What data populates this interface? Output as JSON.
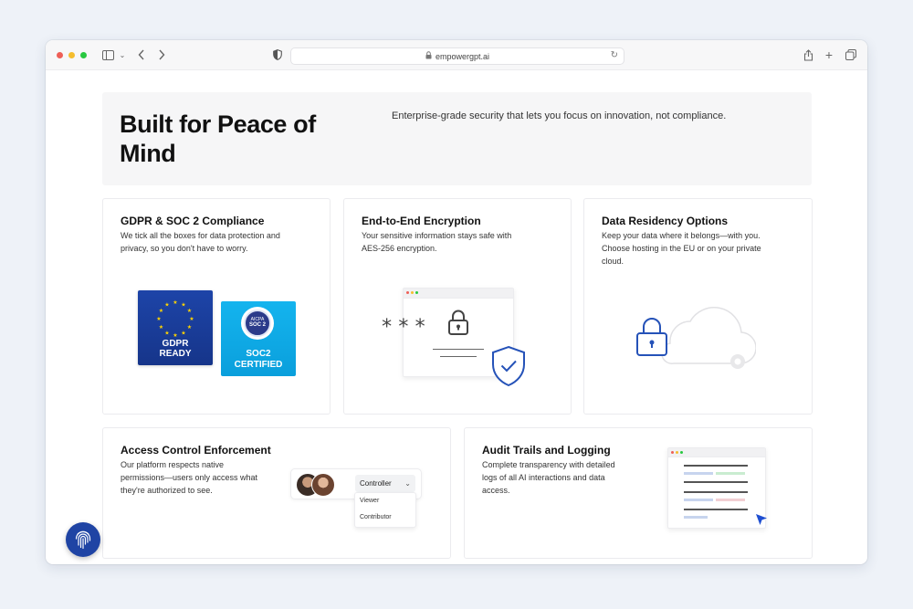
{
  "browser": {
    "url": "empowergpt.ai",
    "colors": {
      "close": "#ee5f57",
      "minimize": "#f5bd2e",
      "zoom": "#28c840"
    }
  },
  "hero": {
    "title": "Built for Peace of Mind",
    "subtitle": "Enterprise-grade security that lets you focus on innovation, not compliance."
  },
  "cards": {
    "gdpr": {
      "title": "GDPR & SOC 2 Compliance",
      "desc_line1": "We tick all the boxes for data protection and",
      "desc_line2": "privacy, so you don't have to worry.",
      "badge1_line1": "GDPR",
      "badge1_line2": "READY",
      "badge2_seal_top": "AICPA",
      "badge2_seal_main": "SOC 2",
      "badge2_line1": "SOC2",
      "badge2_line2": "CERTIFIED"
    },
    "encryption": {
      "title": "End-to-End Encryption",
      "desc_line1": "Your sensitive information stays safe with",
      "desc_line2": "AES-256 encryption.",
      "masked": "***"
    },
    "residency": {
      "title": "Data Residency Options",
      "desc_line1": "Keep your data where it belongs—with you.",
      "desc_line2": "Choose hosting in the EU or on your private",
      "desc_line3": "cloud."
    },
    "access": {
      "title": "Access Control Enforcement",
      "desc_line1": "Our platform respects native",
      "desc_line2": "permissions—users only access what",
      "desc_line3": "they're authorized to see.",
      "selected_role": "Controller",
      "options": [
        "Viewer",
        "Contributor"
      ]
    },
    "audit": {
      "title": "Audit Trails and Logging",
      "desc_line1": "Complete transparency with detailed",
      "desc_line2": "logs of all AI interactions and data",
      "desc_line3": "access."
    }
  },
  "accent": "#1f44a4",
  "icons": [
    "sidebar-icon",
    "chevron-left-icon",
    "chevron-right-icon",
    "shield-icon",
    "lock-icon",
    "reload-icon",
    "share-icon",
    "plus-icon",
    "tabs-icon",
    "fingerprint-icon"
  ]
}
